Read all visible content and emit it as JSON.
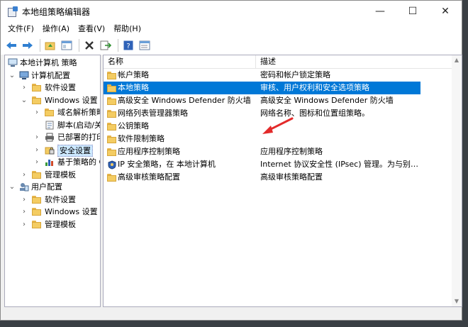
{
  "window": {
    "title": "本地组策略编辑器",
    "controls": [
      "—",
      "☐",
      "✕"
    ]
  },
  "menubar": {
    "items": [
      "文件(F)",
      "操作(A)",
      "查看(V)",
      "帮助(H)"
    ]
  },
  "toolbar": {
    "buttons": [
      "back-arrow-icon",
      "forward-arrow-icon",
      "up-folder-icon",
      "show-tree-icon",
      "delete-icon",
      "export-list-icon",
      "help-icon",
      "properties-icon"
    ]
  },
  "tree": {
    "items": [
      {
        "label": "本地计算机 策略",
        "expander": "",
        "icon": "computer-policy-icon"
      },
      {
        "label": "计算机配置",
        "expander": "⌄",
        "icon": "computer-icon"
      },
      {
        "label": "软件设置",
        "expander": "›",
        "icon": "folder-icon"
      },
      {
        "label": "Windows 设置",
        "expander": "⌄",
        "icon": "folder-icon"
      },
      {
        "label": "域名解析策略",
        "expander": "›",
        "icon": "folder-icon"
      },
      {
        "label": "脚本(启动/关",
        "expander": "",
        "icon": "script-icon"
      },
      {
        "label": "已部署的打印",
        "expander": "›",
        "icon": "printer-icon"
      },
      {
        "label": "安全设置",
        "expander": "›",
        "icon": "security-icon"
      },
      {
        "label": "基于策略的 C",
        "expander": "›",
        "icon": "chart-icon"
      },
      {
        "label": "管理模板",
        "expander": "›",
        "icon": "folder-icon"
      },
      {
        "label": "用户配置",
        "expander": "⌄",
        "icon": "user-icon"
      },
      {
        "label": "软件设置",
        "expander": "›",
        "icon": "folder-icon"
      },
      {
        "label": "Windows 设置",
        "expander": "›",
        "icon": "folder-icon"
      },
      {
        "label": "管理模板",
        "expander": "›",
        "icon": "folder-icon"
      }
    ]
  },
  "list": {
    "columns": [
      "名称",
      "描述"
    ],
    "rows": [
      {
        "name": "帐户策略",
        "desc": "密码和帐户锁定策略",
        "icon": "folder-icon"
      },
      {
        "name": "本地策略",
        "desc": "审核、用户权利和安全选项策略",
        "icon": "folder-icon"
      },
      {
        "name": "高级安全 Windows Defender 防火墙",
        "desc": "高级安全 Windows Defender 防火墙",
        "icon": "folder-icon"
      },
      {
        "name": "网络列表管理器策略",
        "desc": "网络名称、图标和位置组策略。",
        "icon": "folder-icon"
      },
      {
        "name": "公钥策略",
        "desc": "",
        "icon": "folder-icon"
      },
      {
        "name": "软件限制策略",
        "desc": "",
        "icon": "folder-icon"
      },
      {
        "name": "应用程序控制策略",
        "desc": "应用程序控制策略",
        "icon": "folder-icon"
      },
      {
        "name": "IP 安全策略，在 本地计算机",
        "desc": "Internet 协议安全性 (IPsec) 管理。为与别的...",
        "icon": "ip-security-icon"
      },
      {
        "name": "高级审核策略配置",
        "desc": "高级审核策略配置",
        "icon": "folder-icon"
      }
    ]
  },
  "colors": {
    "selection": "#0078d7",
    "tree_selection": "#cce8ff",
    "annotation_arrow": "#e32a2a"
  }
}
